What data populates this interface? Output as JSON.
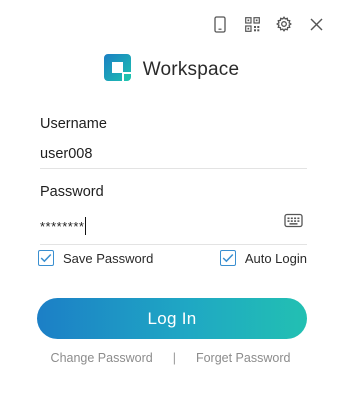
{
  "toolbar": {
    "icons": [
      "mobile-icon",
      "qr-code-icon",
      "gear-icon",
      "close-icon"
    ]
  },
  "brand": {
    "name": "Workspace",
    "logo_colors": [
      "#1b7fc4",
      "#1ec1b0"
    ]
  },
  "username": {
    "label": "Username",
    "value": "user008"
  },
  "password": {
    "label": "Password",
    "value": "********",
    "icon": "keyboard-icon"
  },
  "options": {
    "save_password": {
      "label": "Save Password",
      "checked": true
    },
    "auto_login": {
      "label": "Auto Login",
      "checked": true
    }
  },
  "login_button": {
    "label": "Log In",
    "gradient": [
      "#1c7fc6",
      "#22c0b2"
    ]
  },
  "links": {
    "change_password": "Change Password",
    "separator": "|",
    "forget_password": "Forget Password"
  },
  "colors": {
    "accent": "#3a8fd0",
    "link": "#8c8c8c"
  }
}
